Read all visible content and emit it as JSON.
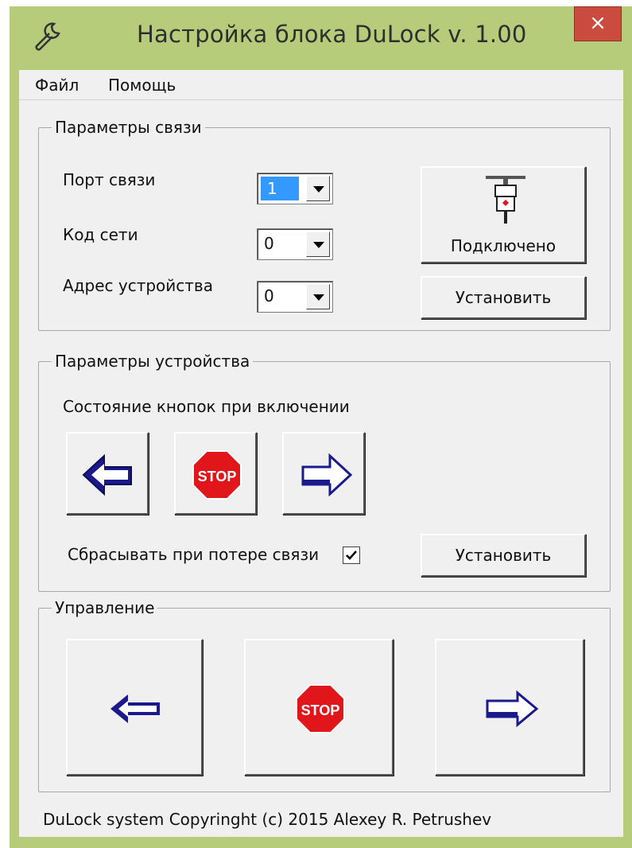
{
  "window": {
    "title": "Настройка блока  DuLock  v. 1.00",
    "close_label": "×"
  },
  "menu": {
    "items": [
      "Файл",
      "Помощь"
    ]
  },
  "connection": {
    "group_title": "Параметры связи",
    "port_label": "Порт связи",
    "port_value": "1",
    "netcode_label": "Код сети",
    "netcode_value": "0",
    "address_label": "Адрес устройства",
    "address_value": "0",
    "connect_button_label": "Подключено",
    "connect_icon": "serial-connector-icon",
    "set_button_label": "Установить"
  },
  "device": {
    "group_title": "Параметры устройства",
    "buttons_state_label": "Состояние кнопок при включении",
    "reset_label": "Сбрасывать при потере связи",
    "reset_checked": true,
    "set_button_label": "Установить",
    "stop_text": "STOP",
    "icons": [
      "arrow-left-icon",
      "stop-sign-icon",
      "arrow-right-icon"
    ]
  },
  "control": {
    "group_title": "Управление",
    "stop_text": "STOP",
    "icons": [
      "arrow-left-icon",
      "stop-sign-icon",
      "arrow-right-icon"
    ]
  },
  "status": {
    "text": "DuLock system Copyringht (c) 2015 Alexey R. Petrushev"
  },
  "colors": {
    "titlebar": "#b6cc7a",
    "close": "#c94c3e",
    "selection": "#3399ff",
    "stop_red": "#e0161b",
    "arrow_blue": "#1a1a8c"
  }
}
